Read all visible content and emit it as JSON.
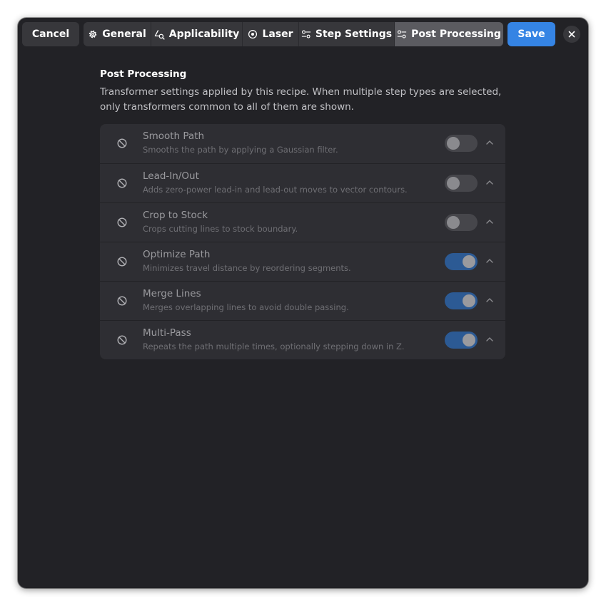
{
  "toolbar": {
    "cancel_label": "Cancel",
    "save_label": "Save",
    "close_icon": "close-icon"
  },
  "tabs": [
    {
      "label": "General",
      "icon": "gear-icon",
      "active": false
    },
    {
      "label": "Applicability",
      "icon": "shapes-search-icon",
      "active": false
    },
    {
      "label": "Laser",
      "icon": "target-icon",
      "active": false
    },
    {
      "label": "Step Settings",
      "icon": "sliders-icon",
      "active": false
    },
    {
      "label": "Post Processing",
      "icon": "sliders-icon",
      "active": true
    }
  ],
  "section": {
    "title": "Post Processing",
    "description": "Transformer settings applied by this recipe. When multiple step types are selected, only transformers common to all of them are shown."
  },
  "transformers": [
    {
      "title": "Smooth Path",
      "subtitle": "Smooths the path by applying a Gaussian filter.",
      "enabled": false
    },
    {
      "title": "Lead-In/Out",
      "subtitle": "Adds zero-power lead-in and lead-out moves to vector contours.",
      "enabled": false
    },
    {
      "title": "Crop to Stock",
      "subtitle": "Crops cutting lines to stock boundary.",
      "enabled": false
    },
    {
      "title": "Optimize Path",
      "subtitle": "Minimizes travel distance by reordering segments.",
      "enabled": true
    },
    {
      "title": "Merge Lines",
      "subtitle": "Merges overlapping lines to avoid double passing.",
      "enabled": true
    },
    {
      "title": "Multi-Pass",
      "subtitle": "Repeats the path multiple times, optionally stepping down in Z.",
      "enabled": true
    }
  ],
  "colors": {
    "window_bg": "#222226",
    "accent": "#3584e4",
    "switch_on": "#2c5a94"
  }
}
